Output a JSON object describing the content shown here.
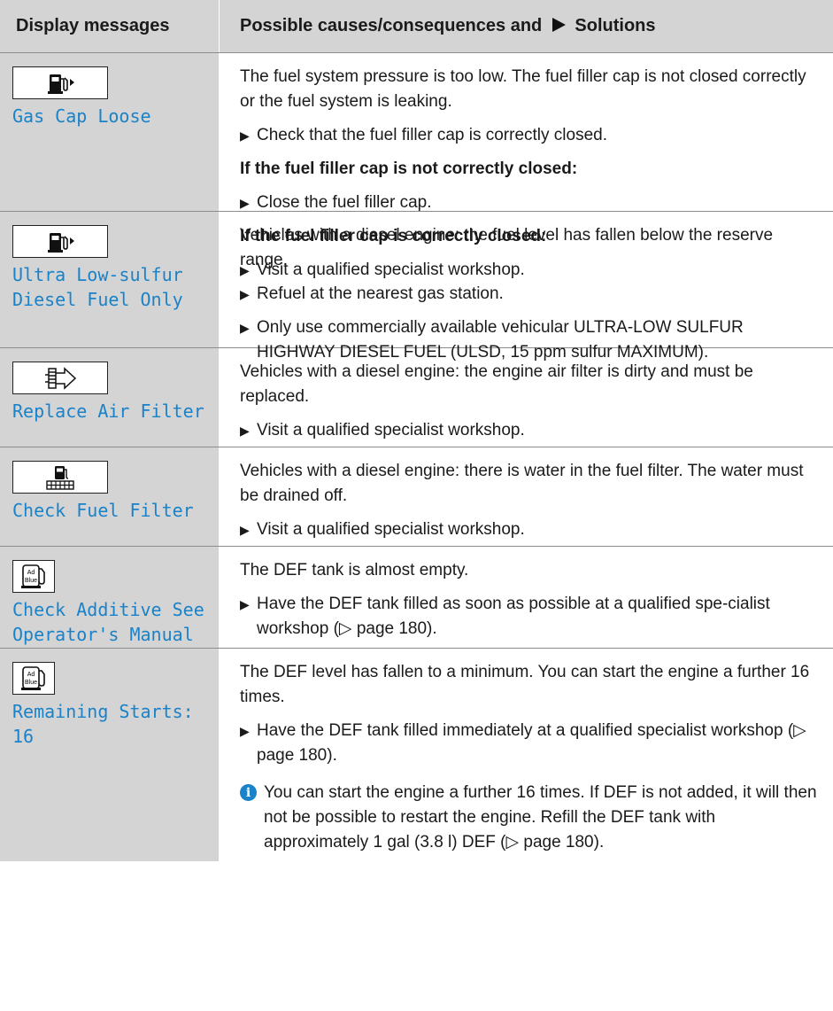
{
  "header": {
    "col1": "Display messages",
    "col2_prefix": "Possible causes/consequences and",
    "col2_suffix": "Solutions"
  },
  "rows": [
    {
      "icon": "fuel-pump-icon",
      "message": "Gas Cap Loose",
      "cause": "The fuel system pressure is too low. The fuel filler cap is not closed correctly or the fuel system is leaking.",
      "step1": "Check that the fuel filler cap is correctly closed.",
      "heading1": "If the fuel filler cap is not correctly closed:",
      "step2": "Close the fuel filler cap.",
      "heading2": "If the fuel filler cap is correctly closed:",
      "step3": "Visit a qualified specialist workshop."
    },
    {
      "icon": "fuel-pump-icon",
      "message": "Ultra Low-sulfur\nDiesel Fuel Only",
      "cause": "Vehicles with a diesel engine: the fuel level has fallen below the reserve range.",
      "step1": "Refuel at the nearest gas station.",
      "step2": "Only use commercially available vehicular ULTRA-LOW SULFUR HIGHWAY DIESEL FUEL (ULSD, 15 ppm sulfur MAXIMUM)."
    },
    {
      "icon": "air-filter-icon",
      "message": "Replace Air Filter",
      "cause": "Vehicles with a diesel engine: the engine air filter is dirty and must be replaced.",
      "step1": "Visit a qualified specialist workshop."
    },
    {
      "icon": "fuel-filter-icon",
      "message": "Check Fuel Filter",
      "cause": "Vehicles with a diesel engine: there is water in the fuel filter. The water must be drained off.",
      "step1": "Visit a qualified specialist workshop."
    },
    {
      "icon": "adblue-icon",
      "icon_text_top": "Ad",
      "icon_text_bottom": "Blue",
      "message": "Check Additive See\nOperator's Manual",
      "cause": "The DEF tank is almost empty.",
      "step1": "Have the DEF tank filled as soon as possible at a qualified spe-cialist workshop (▷ page 180)."
    },
    {
      "icon": "adblue-icon",
      "icon_text_top": "Ad",
      "icon_text_bottom": "Blue",
      "message": "Remaining Starts:\n16",
      "cause": "The DEF level has fallen to a minimum. You can start the engine a further 16 times.",
      "step1": "Have the DEF tank filled immediately at a qualified specialist workshop (▷ page 180).",
      "info_icon": "i",
      "info": "You can start the engine a further 16 times. If DEF is not added, it will then not be possible to restart the engine. Refill the DEF tank with approximately 1 gal (3.8 l) DEF (▷ page 180)."
    }
  ]
}
